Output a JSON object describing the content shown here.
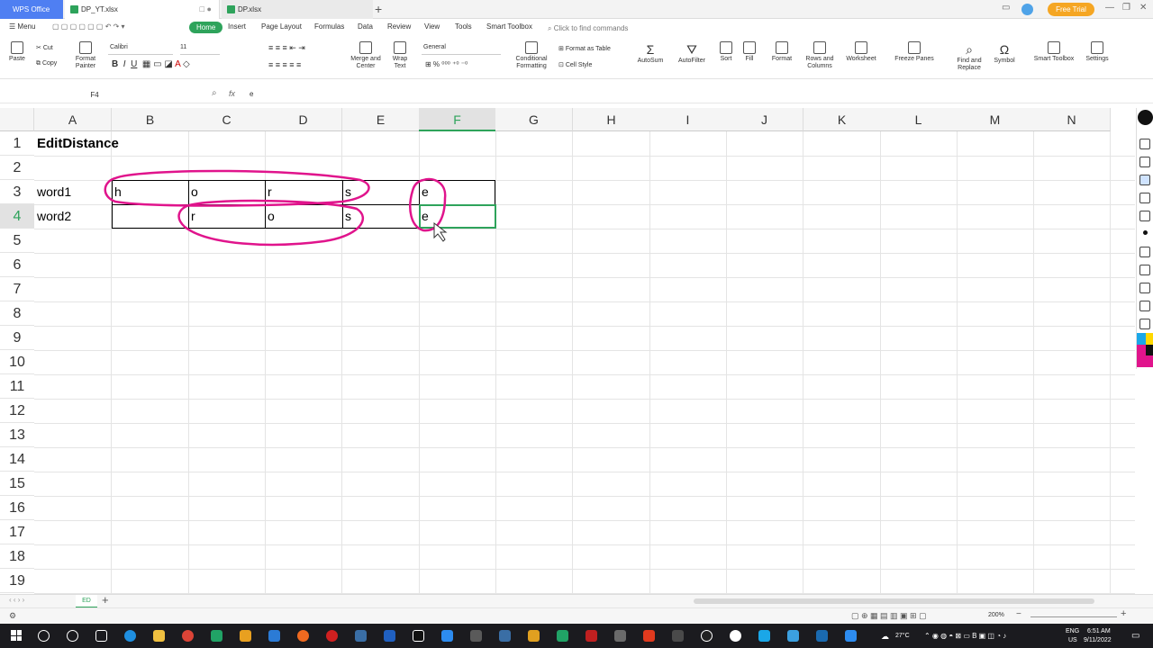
{
  "titlebar": {
    "app_tab": "WPS Office",
    "tabs": [
      {
        "label": "DP_YT.xlsx"
      },
      {
        "label": "DP.xlsx"
      }
    ],
    "free_trial": "Free Trial"
  },
  "menu": {
    "menu_label": "Menu",
    "items": [
      "Home",
      "Insert",
      "Page Layout",
      "Formulas",
      "Data",
      "Review",
      "View",
      "Tools",
      "Smart Toolbox"
    ],
    "find": "Click to find commands"
  },
  "ribbon": {
    "cut": "Cut",
    "copy": "Copy",
    "paste": "Paste",
    "format_painter": "Format\nPainter",
    "font": "Calibri",
    "size": "11",
    "merge": "Merge and\nCenter",
    "wrap": "Wrap\nText",
    "number_format": "General",
    "conditional": "Conditional\nFormatting",
    "format_as_table": "Format as Table",
    "cell_style": "Cell Style",
    "autosum": "AutoSum",
    "autofilter": "AutoFilter",
    "sort": "Sort",
    "fill": "Fill",
    "format": "Format",
    "rows_cols": "Rows and\nColumns",
    "worksheet": "Worksheet",
    "freeze": "Freeze Panes",
    "find_replace": "Find and\nReplace",
    "symbol": "Symbol",
    "smart_toolbox": "Smart Toolbox",
    "settings": "Settings"
  },
  "formula_bar": {
    "name_box": "F4",
    "fx": "fx",
    "value": "e"
  },
  "grid": {
    "columns": [
      "A",
      "B",
      "C",
      "D",
      "E",
      "F",
      "G",
      "H",
      "I",
      "J",
      "K",
      "L",
      "M",
      "N"
    ],
    "rows": [
      "1",
      "2",
      "3",
      "4",
      "5",
      "6",
      "7",
      "8",
      "9",
      "10",
      "11",
      "12",
      "13",
      "14",
      "15",
      "16",
      "17",
      "18",
      "19"
    ],
    "selected_column": "F",
    "selected_row": "4",
    "cells": {
      "A1": "EditDistance",
      "A3": "word1",
      "B3": "h",
      "C3": "o",
      "D3": "r",
      "E3": "s",
      "F3": "e",
      "A4": "word2",
      "C4": "r",
      "D4": "o",
      "E4": "s",
      "F4": "e"
    },
    "annotation_color": "#e0148c",
    "accent": "#2ea35b"
  },
  "sheets": {
    "tabs": [
      "ED"
    ]
  },
  "status": {
    "zoom": "200%"
  },
  "taskbar": {
    "weather": "27°C",
    "lang": "ENG",
    "region": "US",
    "time": "6:51 AM",
    "date": "9/11/2022"
  }
}
